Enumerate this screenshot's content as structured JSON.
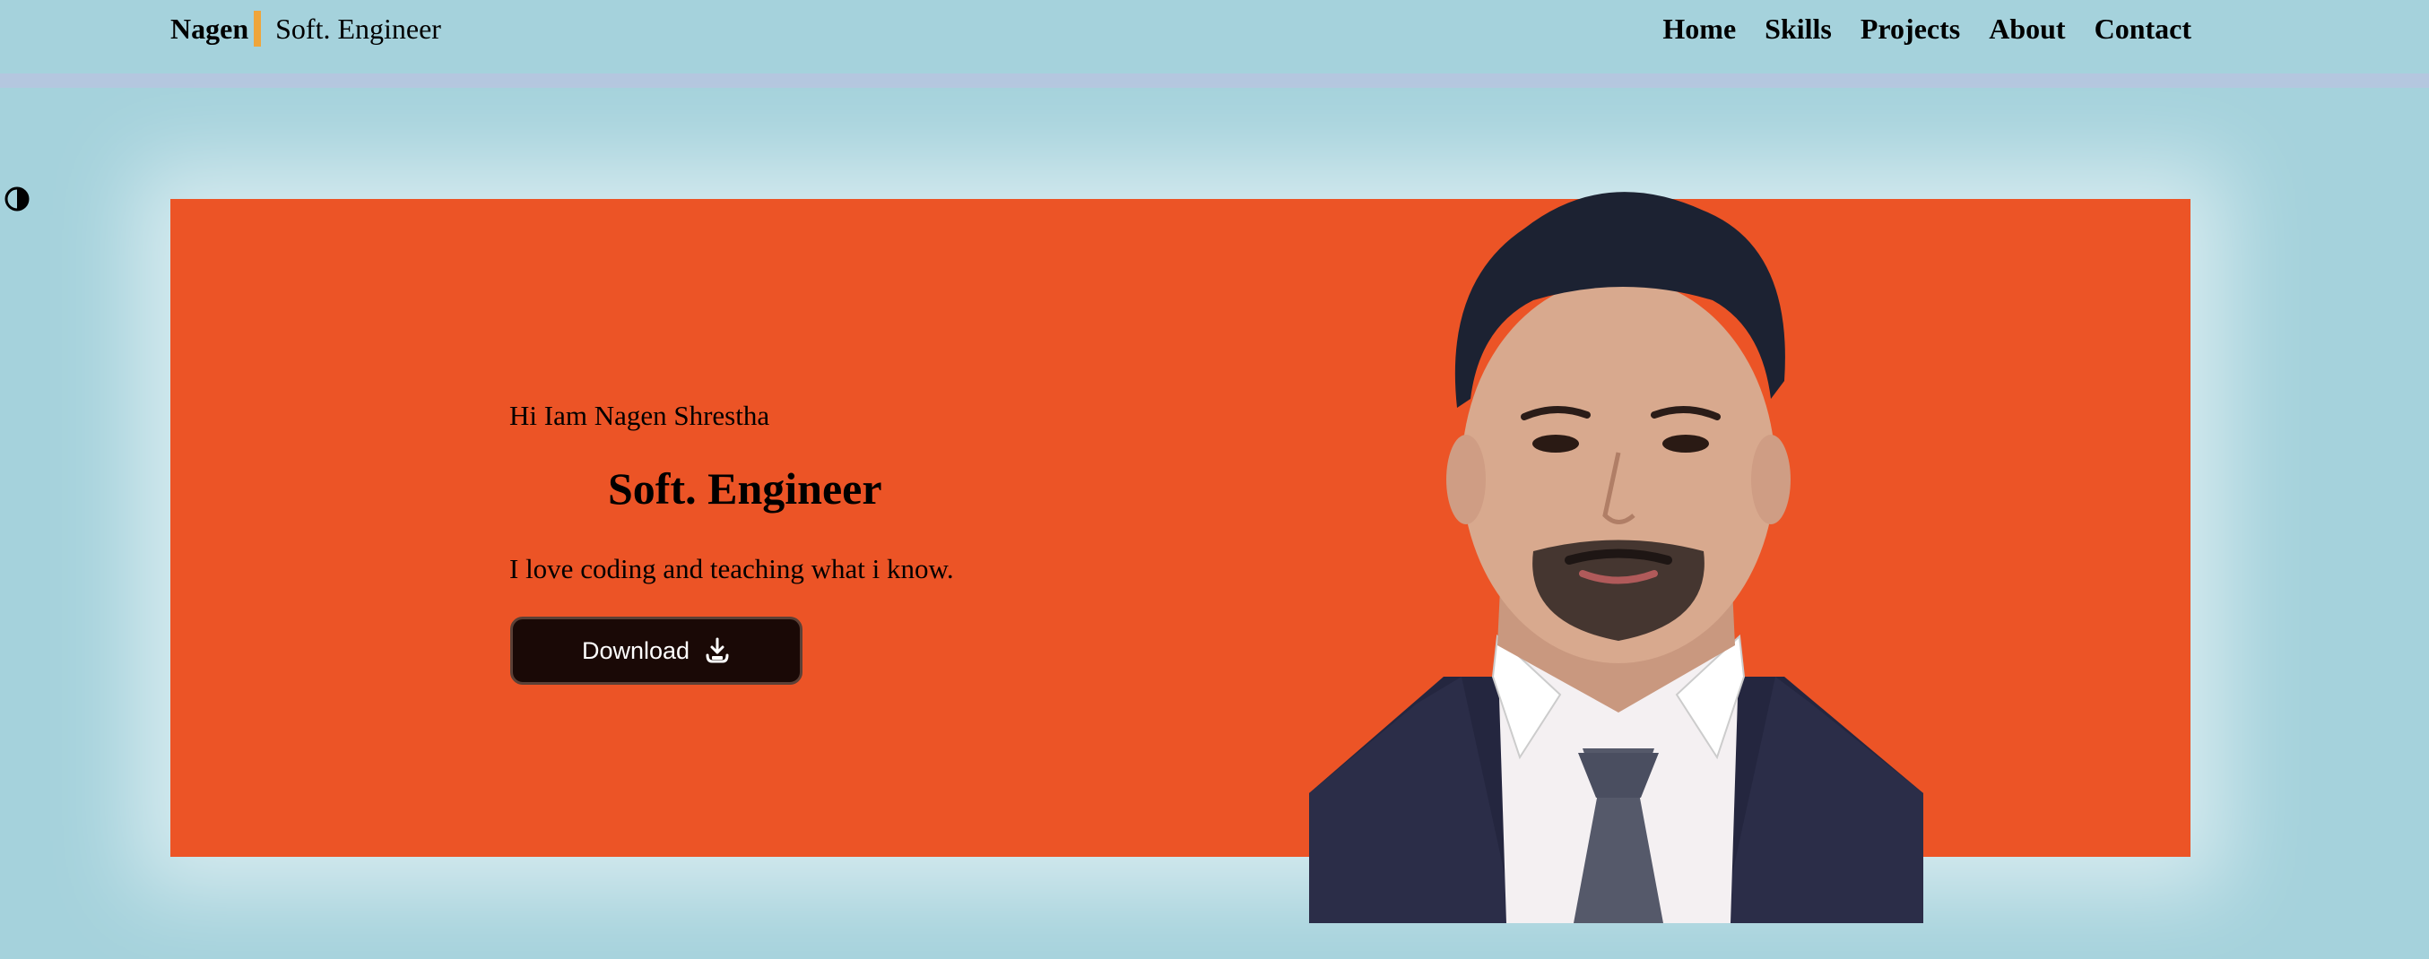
{
  "header": {
    "brand_name": "Nagen",
    "brand_subtitle": "Soft. Engineer",
    "nav": [
      "Home",
      "Skills",
      "Projects",
      "About",
      "Contact"
    ]
  },
  "theme_toggle": {
    "icon": "contrast-icon"
  },
  "hero": {
    "greeting": "Hi Iam Nagen Shrestha",
    "title": "Soft. Engineer",
    "tagline": "I love coding and teaching what i know.",
    "download_label": "Download",
    "download_icon": "download-icon",
    "portrait": "profile-photo"
  },
  "colors": {
    "page_bg": "#a5d2dc",
    "hero_bg": "#ec5426",
    "accent_bar": "#f0a53a",
    "button_bg": "#1a0906"
  }
}
